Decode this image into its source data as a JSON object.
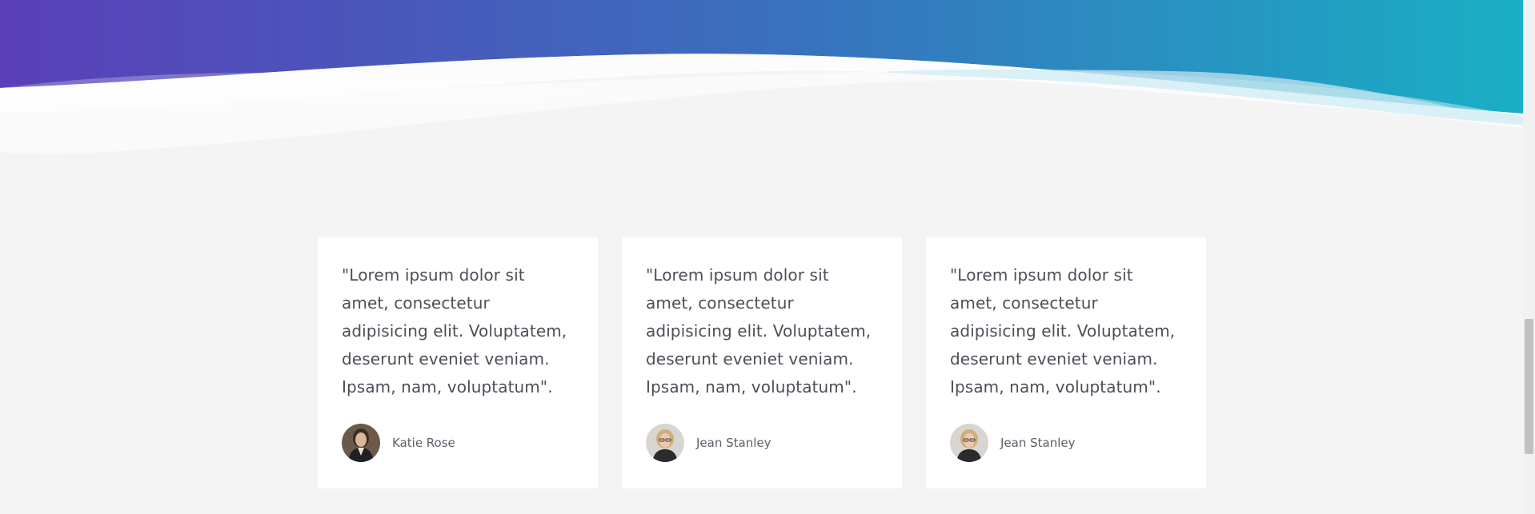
{
  "colors": {
    "page_background": "#f4f4f4",
    "hero_gradient_start": "#5a3fb8",
    "hero_gradient_end": "#1aafc4"
  },
  "testimonials": [
    {
      "quote": "\"Lorem ipsum dolor sit amet, consectetur adipisicing elit. Voluptatem, deserunt eveniet veniam. Ipsam, nam, voluptatum\".",
      "author": "Katie Rose",
      "avatar_icon": "avatar-photo-dark-hair"
    },
    {
      "quote": "\"Lorem ipsum dolor sit amet, consectetur adipisicing elit. Voluptatem, deserunt eveniet veniam. Ipsam, nam, voluptatum\".",
      "author": "Jean Stanley",
      "avatar_icon": "avatar-photo-blonde-glasses"
    },
    {
      "quote": "\"Lorem ipsum dolor sit amet, consectetur adipisicing elit. Voluptatem, deserunt eveniet veniam. Ipsam, nam, voluptatum\".",
      "author": "Jean Stanley",
      "avatar_icon": "avatar-photo-blonde-glasses"
    }
  ]
}
